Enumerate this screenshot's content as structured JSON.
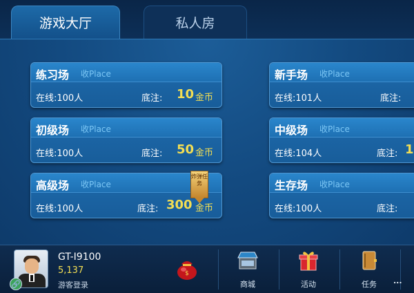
{
  "tabs": [
    {
      "label": "游戏大厅",
      "active": true
    },
    {
      "label": "私人房",
      "active": false
    }
  ],
  "rooms": [
    {
      "name": "练习场",
      "place": "收Place",
      "online": "在线:100人",
      "bet_label": "底注:",
      "amount": "10",
      "coin": "金币"
    },
    {
      "name": "新手场",
      "place": "收Place",
      "online": "在线:101人",
      "bet_label": "底注:",
      "amount": "",
      "coin": ""
    },
    {
      "name": "初级场",
      "place": "收Place",
      "online": "在线:100人",
      "bet_label": "底注:",
      "amount": "50",
      "coin": "金币"
    },
    {
      "name": "中级场",
      "place": "收Place",
      "online": "在线:104人",
      "bet_label": "底注:",
      "amount": "1",
      "coin": ""
    },
    {
      "name": "高级场",
      "place": "收Place",
      "online": "在线:100人",
      "bet_label": "底注:",
      "amount": "300",
      "coin": "金币"
    },
    {
      "name": "生存场",
      "place": "收Place",
      "online": "在线:100人",
      "bet_label": "底注:",
      "amount": "",
      "coin": ""
    }
  ],
  "badge": {
    "text": "炸弹任务"
  },
  "user": {
    "name": "GT-I9100",
    "coins": "5,137",
    "login": "游客登录"
  },
  "menu": [
    {
      "label": "商城",
      "icon": "shop-icon"
    },
    {
      "label": "活动",
      "icon": "gift-box-icon"
    },
    {
      "label": "任务",
      "icon": "task-book-icon"
    }
  ],
  "watermark": "...",
  "colors": {
    "accent": "#f3de53",
    "place": "#7cc7f5",
    "panel": "#1e6aac"
  }
}
